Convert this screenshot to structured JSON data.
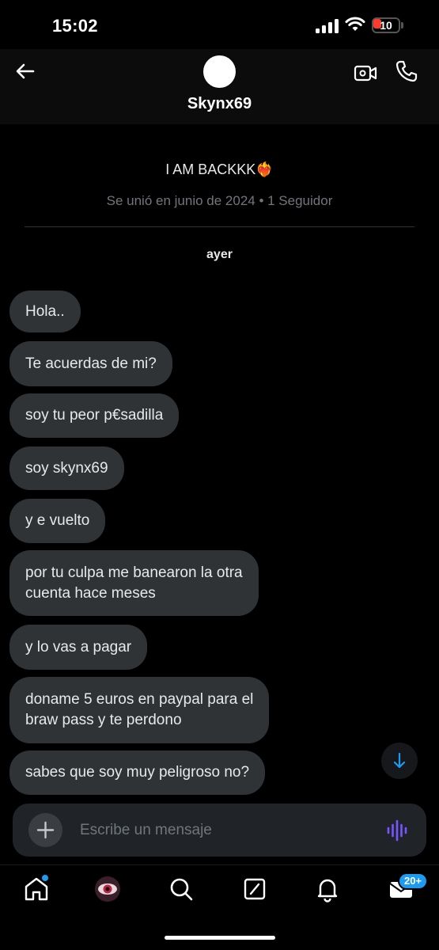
{
  "status_bar": {
    "time": "15:02",
    "battery": "10",
    "icons": [
      "cellular-signal-icon",
      "wifi-icon",
      "battery-icon"
    ]
  },
  "header": {
    "username": "Skynx69",
    "icons": [
      "back-arrow-icon",
      "video-call-icon",
      "phone-icon"
    ]
  },
  "profile": {
    "bio_text": "I AM BACKKK",
    "bio_emoji": "❤️‍🔥",
    "meta": "Se unió en junio de 2024 • 1 Seguidor"
  },
  "day_label": "ayer",
  "messages": [
    {
      "text": "Hola.."
    },
    {
      "text": "Te acuerdas de mi?"
    },
    {
      "text": "soy tu peor p€sadilla"
    },
    {
      "text": "soy skynx69"
    },
    {
      "text": "y e vuelto"
    },
    {
      "text": "por tu culpa me banearon la otra\ncuenta hace meses"
    },
    {
      "text": "y lo vas a pagar"
    },
    {
      "text": "doname 5 euros en paypal para el\nbraw pass y te perdono"
    },
    {
      "text": "sabes que soy muy peligroso no?"
    }
  ],
  "composer": {
    "placeholder": "Escribe un mensaje"
  },
  "bottom_nav": {
    "items": [
      "home-icon",
      "profile-avatar",
      "search-icon",
      "grok-icon",
      "notifications-icon",
      "messages-icon"
    ],
    "messages_badge": "20+"
  },
  "colors": {
    "accent": "#1d9bf0",
    "bubble": "#2f3336",
    "voice_icon": "#7856ff"
  }
}
